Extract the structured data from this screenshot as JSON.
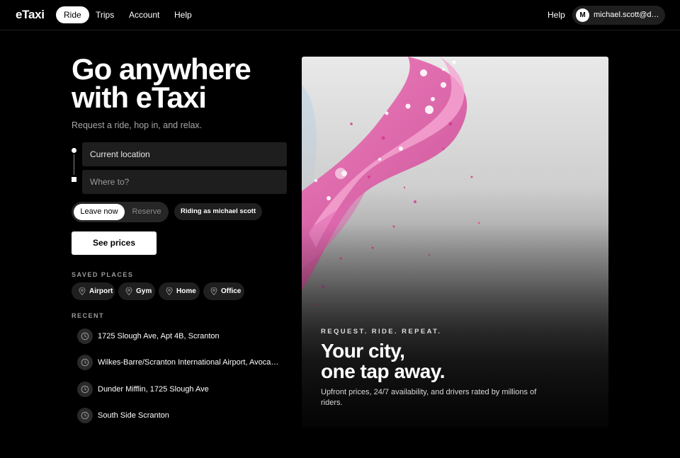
{
  "nav": {
    "logo": "eTaxi",
    "items": [
      {
        "label": "Ride",
        "active": true
      },
      {
        "label": "Trips",
        "active": false
      },
      {
        "label": "Account",
        "active": false
      },
      {
        "label": "Help",
        "active": false
      }
    ],
    "help_right": "Help",
    "user": {
      "initial": "M",
      "name": "michael.scott@du..."
    }
  },
  "hero_left": {
    "headline_line1": "Go anywhere",
    "headline_line2": "with eTaxi",
    "subhead": "Request a ride, hop in, and relax."
  },
  "form": {
    "pickup_value": "Current location",
    "dropoff_placeholder": "Where to?",
    "timing_options": [
      "Leave now",
      "Reserve"
    ],
    "timing_selected": "Leave now",
    "rider": "Riding as michael scott",
    "submit_label": "See prices"
  },
  "saved_places": {
    "label": "SAVED PLACES",
    "items": [
      "Airport",
      "Gym",
      "Home",
      "Office"
    ]
  },
  "recent": {
    "label": "RECENT",
    "items": [
      "1725 Slough Ave, Apt 4B, Scranton",
      "Wilkes-Barre/Scranton International Airport, Avoca, P...",
      "Dunder Mifflin, 1725 Slough Ave",
      "South Side Scranton"
    ]
  },
  "hero_card": {
    "eyebrow": "REQUEST. RIDE. REPEAT.",
    "title_line1": "Your city,",
    "title_line2": "one tap away.",
    "body": "Upfront prices, 24/7 availability, and drivers rated by millions of riders."
  },
  "colors": {
    "background": "#000000",
    "surface": "#1e1e1e",
    "accent_pink": "#e0509e"
  },
  "icons": {
    "saved_place": "map-pin-icon",
    "recent": "clock-icon"
  }
}
